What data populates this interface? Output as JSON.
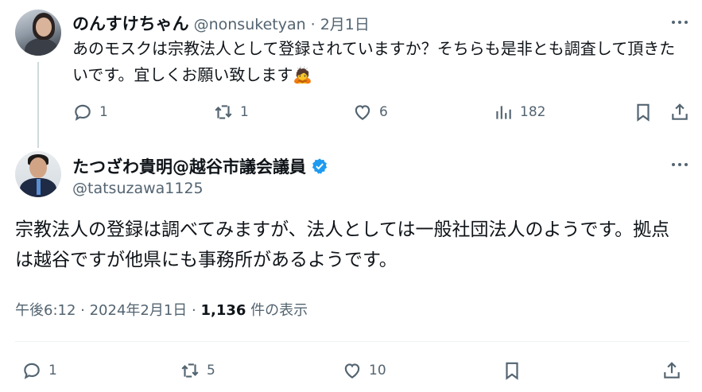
{
  "reply": {
    "display_name": "のんすけちゃん",
    "handle": "@nonsuketyan",
    "separator": "·",
    "date": "2月1日",
    "text": "あのモスクは宗教法人として登録されていますか？そちらも是非とも調査して頂きたいです。宜しくお願い致します",
    "emoji": "🙇",
    "actions": {
      "replies": "1",
      "reposts": "1",
      "likes": "6",
      "views": "182"
    }
  },
  "main": {
    "display_name": "たつざわ貴明@越谷市議会議員",
    "handle": "@tatsuzawa1125",
    "verified_color": "#1d9bf0",
    "text": "宗教法人の登録は調べてみますが、法人としては一般社団法人のようです。拠点は越谷ですが他県にも事務所があるようです。",
    "meta": {
      "time": "午後6:12",
      "sep1": " · ",
      "date": "2024年2月1日",
      "sep2": " · ",
      "views": "1,136",
      "views_label": " 件の表示"
    },
    "actions": {
      "replies": "1",
      "reposts": "5",
      "likes": "10"
    }
  },
  "icons": [
    "reply-icon",
    "repost-icon",
    "like-icon",
    "views-icon",
    "bookmark-icon",
    "share-icon",
    "more-icon",
    "verified-icon"
  ]
}
